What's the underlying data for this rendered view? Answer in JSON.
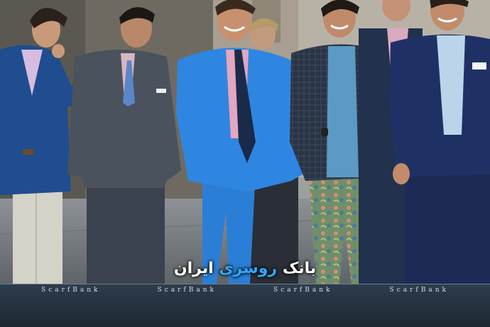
{
  "watermark": {
    "text_main": "بانک ",
    "text_accent": "روسری",
    "text_end": " ایران"
  },
  "footer": {
    "ticker": [
      "ScarfBank",
      "ScarfBank",
      "ScarfBank",
      "ScarfBank"
    ]
  },
  "colors": {
    "footer_bg": "#22303d",
    "accent": "#2fa8ff"
  }
}
